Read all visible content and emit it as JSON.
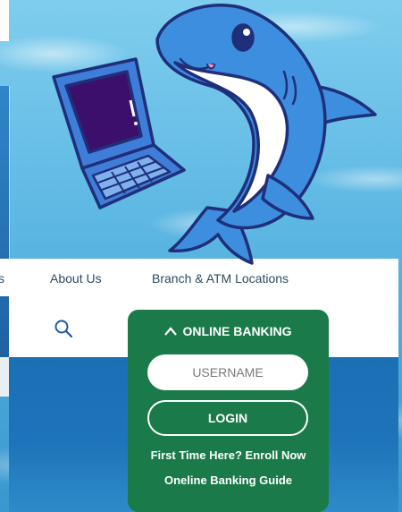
{
  "nav": {
    "fragment": "s",
    "about": "About Us",
    "branch": "Branch & ATM Locations"
  },
  "search": {
    "icon": "search-icon"
  },
  "online_banking": {
    "header": "ONLINE BANKING",
    "chevron_icon": "chevron-up-icon",
    "username_placeholder": "USERNAME",
    "login_label": "LOGIN",
    "enroll_link": "First Time Here? Enroll Now",
    "guide_link": "Oneline Banking Guide"
  },
  "colors": {
    "card_green": "#1a7a4a",
    "nav_text": "#2d4a63",
    "hero_blue": "#1b6fb5",
    "water": "#5fb9e4"
  }
}
